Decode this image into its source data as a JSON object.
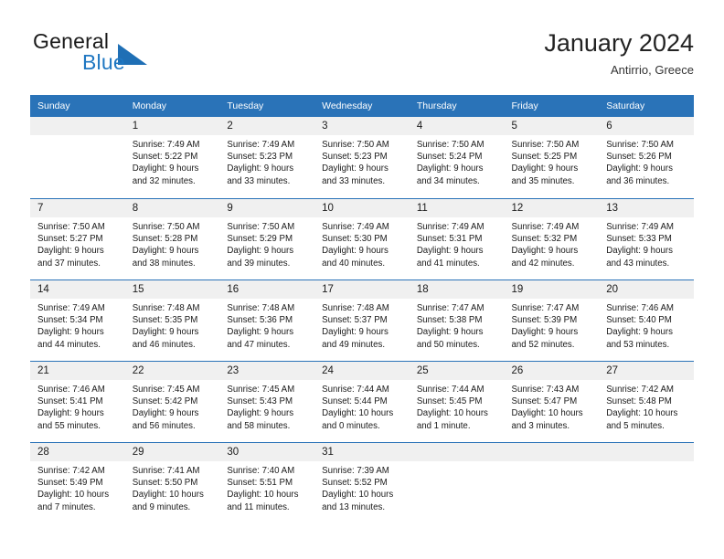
{
  "brand": {
    "name_part1": "General",
    "name_part2": "Blue",
    "logo_icon": "triangle-logo-icon",
    "accent_color": "#1f6fb5"
  },
  "header": {
    "title": "January 2024",
    "location": "Antirrio, Greece"
  },
  "colors": {
    "header_blue": "#2a73b8",
    "daynum_band": "#f0f0f0",
    "text": "#1a1a1a"
  },
  "weekday_headers": [
    "Sunday",
    "Monday",
    "Tuesday",
    "Wednesday",
    "Thursday",
    "Friday",
    "Saturday"
  ],
  "weeks": [
    [
      {
        "day": "",
        "empty": true,
        "sunrise": "",
        "sunset": "",
        "daylight1": "",
        "daylight2": ""
      },
      {
        "day": "1",
        "sunrise": "Sunrise: 7:49 AM",
        "sunset": "Sunset: 5:22 PM",
        "daylight1": "Daylight: 9 hours",
        "daylight2": "and 32 minutes."
      },
      {
        "day": "2",
        "sunrise": "Sunrise: 7:49 AM",
        "sunset": "Sunset: 5:23 PM",
        "daylight1": "Daylight: 9 hours",
        "daylight2": "and 33 minutes."
      },
      {
        "day": "3",
        "sunrise": "Sunrise: 7:50 AM",
        "sunset": "Sunset: 5:23 PM",
        "daylight1": "Daylight: 9 hours",
        "daylight2": "and 33 minutes."
      },
      {
        "day": "4",
        "sunrise": "Sunrise: 7:50 AM",
        "sunset": "Sunset: 5:24 PM",
        "daylight1": "Daylight: 9 hours",
        "daylight2": "and 34 minutes."
      },
      {
        "day": "5",
        "sunrise": "Sunrise: 7:50 AM",
        "sunset": "Sunset: 5:25 PM",
        "daylight1": "Daylight: 9 hours",
        "daylight2": "and 35 minutes."
      },
      {
        "day": "6",
        "sunrise": "Sunrise: 7:50 AM",
        "sunset": "Sunset: 5:26 PM",
        "daylight1": "Daylight: 9 hours",
        "daylight2": "and 36 minutes."
      }
    ],
    [
      {
        "day": "7",
        "sunrise": "Sunrise: 7:50 AM",
        "sunset": "Sunset: 5:27 PM",
        "daylight1": "Daylight: 9 hours",
        "daylight2": "and 37 minutes."
      },
      {
        "day": "8",
        "sunrise": "Sunrise: 7:50 AM",
        "sunset": "Sunset: 5:28 PM",
        "daylight1": "Daylight: 9 hours",
        "daylight2": "and 38 minutes."
      },
      {
        "day": "9",
        "sunrise": "Sunrise: 7:50 AM",
        "sunset": "Sunset: 5:29 PM",
        "daylight1": "Daylight: 9 hours",
        "daylight2": "and 39 minutes."
      },
      {
        "day": "10",
        "sunrise": "Sunrise: 7:49 AM",
        "sunset": "Sunset: 5:30 PM",
        "daylight1": "Daylight: 9 hours",
        "daylight2": "and 40 minutes."
      },
      {
        "day": "11",
        "sunrise": "Sunrise: 7:49 AM",
        "sunset": "Sunset: 5:31 PM",
        "daylight1": "Daylight: 9 hours",
        "daylight2": "and 41 minutes."
      },
      {
        "day": "12",
        "sunrise": "Sunrise: 7:49 AM",
        "sunset": "Sunset: 5:32 PM",
        "daylight1": "Daylight: 9 hours",
        "daylight2": "and 42 minutes."
      },
      {
        "day": "13",
        "sunrise": "Sunrise: 7:49 AM",
        "sunset": "Sunset: 5:33 PM",
        "daylight1": "Daylight: 9 hours",
        "daylight2": "and 43 minutes."
      }
    ],
    [
      {
        "day": "14",
        "sunrise": "Sunrise: 7:49 AM",
        "sunset": "Sunset: 5:34 PM",
        "daylight1": "Daylight: 9 hours",
        "daylight2": "and 44 minutes."
      },
      {
        "day": "15",
        "sunrise": "Sunrise: 7:48 AM",
        "sunset": "Sunset: 5:35 PM",
        "daylight1": "Daylight: 9 hours",
        "daylight2": "and 46 minutes."
      },
      {
        "day": "16",
        "sunrise": "Sunrise: 7:48 AM",
        "sunset": "Sunset: 5:36 PM",
        "daylight1": "Daylight: 9 hours",
        "daylight2": "and 47 minutes."
      },
      {
        "day": "17",
        "sunrise": "Sunrise: 7:48 AM",
        "sunset": "Sunset: 5:37 PM",
        "daylight1": "Daylight: 9 hours",
        "daylight2": "and 49 minutes."
      },
      {
        "day": "18",
        "sunrise": "Sunrise: 7:47 AM",
        "sunset": "Sunset: 5:38 PM",
        "daylight1": "Daylight: 9 hours",
        "daylight2": "and 50 minutes."
      },
      {
        "day": "19",
        "sunrise": "Sunrise: 7:47 AM",
        "sunset": "Sunset: 5:39 PM",
        "daylight1": "Daylight: 9 hours",
        "daylight2": "and 52 minutes."
      },
      {
        "day": "20",
        "sunrise": "Sunrise: 7:46 AM",
        "sunset": "Sunset: 5:40 PM",
        "daylight1": "Daylight: 9 hours",
        "daylight2": "and 53 minutes."
      }
    ],
    [
      {
        "day": "21",
        "sunrise": "Sunrise: 7:46 AM",
        "sunset": "Sunset: 5:41 PM",
        "daylight1": "Daylight: 9 hours",
        "daylight2": "and 55 minutes."
      },
      {
        "day": "22",
        "sunrise": "Sunrise: 7:45 AM",
        "sunset": "Sunset: 5:42 PM",
        "daylight1": "Daylight: 9 hours",
        "daylight2": "and 56 minutes."
      },
      {
        "day": "23",
        "sunrise": "Sunrise: 7:45 AM",
        "sunset": "Sunset: 5:43 PM",
        "daylight1": "Daylight: 9 hours",
        "daylight2": "and 58 minutes."
      },
      {
        "day": "24",
        "sunrise": "Sunrise: 7:44 AM",
        "sunset": "Sunset: 5:44 PM",
        "daylight1": "Daylight: 10 hours",
        "daylight2": "and 0 minutes."
      },
      {
        "day": "25",
        "sunrise": "Sunrise: 7:44 AM",
        "sunset": "Sunset: 5:45 PM",
        "daylight1": "Daylight: 10 hours",
        "daylight2": "and 1 minute."
      },
      {
        "day": "26",
        "sunrise": "Sunrise: 7:43 AM",
        "sunset": "Sunset: 5:47 PM",
        "daylight1": "Daylight: 10 hours",
        "daylight2": "and 3 minutes."
      },
      {
        "day": "27",
        "sunrise": "Sunrise: 7:42 AM",
        "sunset": "Sunset: 5:48 PM",
        "daylight1": "Daylight: 10 hours",
        "daylight2": "and 5 minutes."
      }
    ],
    [
      {
        "day": "28",
        "sunrise": "Sunrise: 7:42 AM",
        "sunset": "Sunset: 5:49 PM",
        "daylight1": "Daylight: 10 hours",
        "daylight2": "and 7 minutes."
      },
      {
        "day": "29",
        "sunrise": "Sunrise: 7:41 AM",
        "sunset": "Sunset: 5:50 PM",
        "daylight1": "Daylight: 10 hours",
        "daylight2": "and 9 minutes."
      },
      {
        "day": "30",
        "sunrise": "Sunrise: 7:40 AM",
        "sunset": "Sunset: 5:51 PM",
        "daylight1": "Daylight: 10 hours",
        "daylight2": "and 11 minutes."
      },
      {
        "day": "31",
        "sunrise": "Sunrise: 7:39 AM",
        "sunset": "Sunset: 5:52 PM",
        "daylight1": "Daylight: 10 hours",
        "daylight2": "and 13 minutes."
      },
      {
        "day": "",
        "empty": true,
        "sunrise": "",
        "sunset": "",
        "daylight1": "",
        "daylight2": ""
      },
      {
        "day": "",
        "empty": true,
        "sunrise": "",
        "sunset": "",
        "daylight1": "",
        "daylight2": ""
      },
      {
        "day": "",
        "empty": true,
        "sunrise": "",
        "sunset": "",
        "daylight1": "",
        "daylight2": ""
      }
    ]
  ]
}
